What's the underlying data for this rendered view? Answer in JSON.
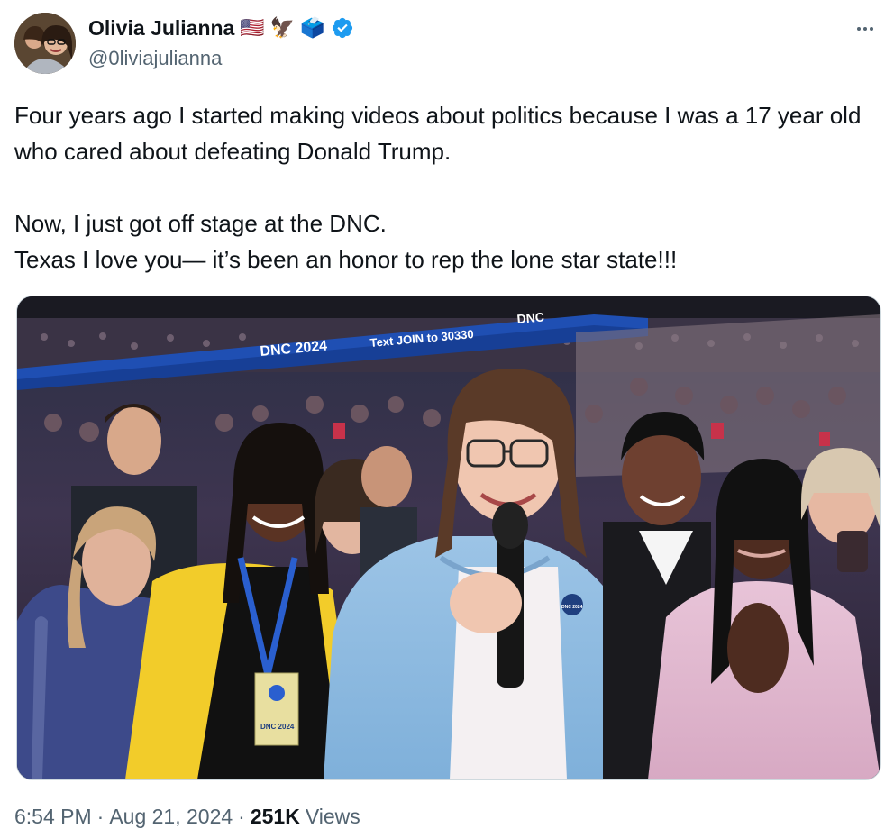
{
  "author": {
    "display_name": "Olivia Julianna",
    "handle": "@0liviajulianna",
    "name_emojis": [
      "🇺🇸",
      "🦅",
      "🗳️"
    ],
    "verified": true,
    "verified_color": "#1d9bf0",
    "avatar_icon": "profile-avatar"
  },
  "tweet": {
    "line1": "Four years ago I started making videos about politics because I was a 17 year old who cared about defeating Donald Trump.",
    "line2": "Now, I just got off stage at the DNC.",
    "line3": "Texas I love you— it’s been an honor to rep the lone star state!!!"
  },
  "media": {
    "banner_text_1": "DNC 2024",
    "banner_text_2": "Text JOIN to 30330",
    "banner_text_3": "DNC",
    "pin_text": "DNC 2024",
    "lanyard_text": "DNC 2024"
  },
  "meta": {
    "time": "6:54 PM",
    "date": "Aug 21, 2024",
    "views_count": "251K",
    "views_label": "Views",
    "separator": "·"
  },
  "icons": {
    "more": "more-options-icon",
    "verified": "verified-badge-icon"
  }
}
